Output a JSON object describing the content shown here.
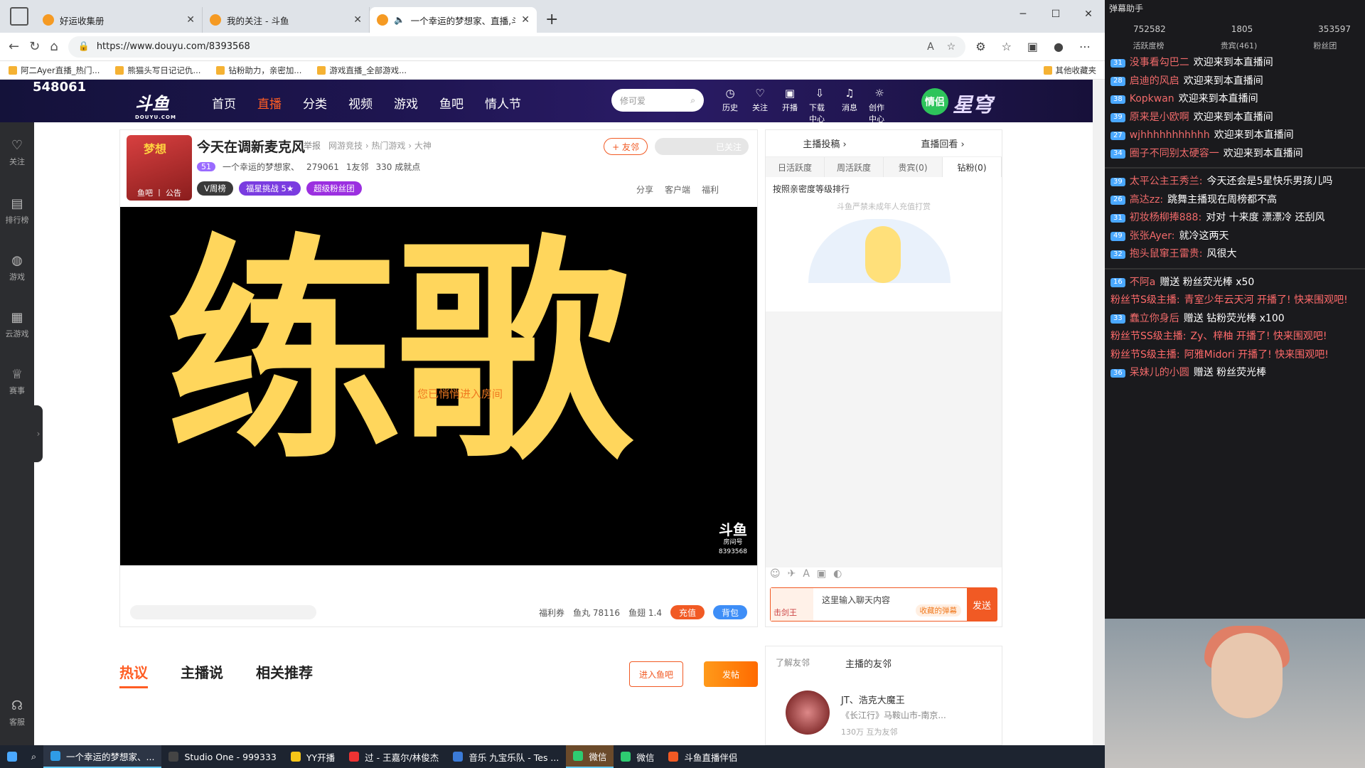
{
  "browser": {
    "tabs": [
      {
        "title": "好运收集册",
        "active": false
      },
      {
        "title": "我的关注 - 斗鱼",
        "active": false
      },
      {
        "title": "一个幸运的梦想家、直播,斗",
        "active": true
      }
    ],
    "url": "https://www.douyu.com/8393568",
    "favorites": [
      "阿二Ayer直播_热门...",
      "熊猫头写日记记仇...",
      "钻粉助力，亲密加...",
      "游戏直播_全部游戏..."
    ],
    "favorites_right": "其他收藏夹"
  },
  "header": {
    "counter": "548061",
    "logo": "斗鱼",
    "logo_sub": "DOUYU.COM",
    "nav": [
      "首页",
      "直播",
      "分类",
      "视频",
      "游戏",
      "鱼吧",
      "情人节"
    ],
    "search_placeholder": "修可爱",
    "icons": [
      "历史",
      "关注",
      "开播",
      "下载中心",
      "消息",
      "创作中心"
    ],
    "badge": "情侣",
    "banner_text": "星穹"
  },
  "left_sidebar": [
    "关注",
    "排行榜",
    "游戏",
    "云游戏",
    "赛事",
    "客服"
  ],
  "room": {
    "avatar_top": "梦想",
    "avatar_bottom": "鱼吧 丨 公告",
    "title": "今天在调新麦克风",
    "report": "举报",
    "category": "网游竞技 › 热门游戏 › 大神",
    "level": "51",
    "anchor": "一个幸运的梦想家、",
    "heat": "279061",
    "friends": "1友邻",
    "achievements": "330 成就点",
    "chips": [
      "V周榜",
      "福星挑战 5★",
      "超级粉丝团"
    ],
    "friend_btn": "+ 友邻",
    "follow_btn": "已关注",
    "tools": [
      "分享",
      "客户端",
      "福利"
    ],
    "video_text": "练歌",
    "enter_msg": "您已悄悄进入房间",
    "watermark": "斗鱼",
    "watermark_sub1": "房间号",
    "watermark_sub2": "8393568",
    "bottom": {
      "coupon": "福利券",
      "fishball": "鱼丸 78116",
      "fishtree": "鱼翅 1.4",
      "recharge": "充值",
      "bag": "背包"
    }
  },
  "subtabs": [
    "热议",
    "主播说",
    "相关推荐"
  ],
  "fish_btn": "进入鱼吧",
  "post_btn": "发帖",
  "right_panel": {
    "top": [
      "主播投稿 ›",
      "直播回看 ›"
    ],
    "tabs": [
      "日活跃度",
      "周活跃度",
      "贵宾(0)",
      "钻粉(0)"
    ],
    "rank_note": "按照亲密度等级排行",
    "minor_note": "斗鱼严禁未成年人充值打赏",
    "chat_left": "击剑王",
    "chat_placeholder": "这里输入聊天内容",
    "chat_tag": "收藏的弹幕",
    "send": "发送"
  },
  "friends_panel": {
    "tab1": "了解友邻",
    "tab2": "主播的友邻",
    "name": "JT、浩克大魔王",
    "desc": "《长江行》马鞍山市-南京...",
    "count": "130万",
    "tag": "互为友邻"
  },
  "danmu": {
    "title": "弹幕助手",
    "stats": [
      "752582",
      "1805",
      "353597"
    ],
    "tabs": [
      "活跃度榜",
      "贵宾(461)",
      "粉丝团"
    ],
    "lines": [
      {
        "badge": "31",
        "user": "没事看勾巴二",
        "msg": "欢迎来到本直播间"
      },
      {
        "badge": "28",
        "user": "启迪的风启",
        "msg": "欢迎来到本直播间"
      },
      {
        "badge": "38",
        "user": "Kopkwan",
        "msg": "欢迎来到本直播间"
      },
      {
        "badge": "39",
        "user": "原来是小欧啊",
        "msg": "欢迎来到本直播间"
      },
      {
        "badge": "27",
        "user": "wjhhhhhhhhhhh",
        "msg": "欢迎来到本直播间"
      },
      {
        "badge": "34",
        "user": "圈子不同别太硬容一",
        "msg": "欢迎来到本直播间"
      }
    ],
    "chat": [
      {
        "badge": "39",
        "user": "太平公主王秀兰:",
        "msg": "今天还会是5星快乐男孩儿吗"
      },
      {
        "badge": "26",
        "user": "高达zz:",
        "msg": "跳舞主播现在周榜都不高"
      },
      {
        "badge": "31",
        "user": "初妆杨柳捧888:",
        "msg": "对对 十来度 漂漂冷 还刮风"
      },
      {
        "badge": "49",
        "user": "张张Ayer:",
        "msg": "就冷这两天"
      },
      {
        "badge": "32",
        "user": "抱头鼠窜王雷贵:",
        "msg": "风很大"
      }
    ],
    "gifts": [
      {
        "badge": "16",
        "user": "不阿a",
        "msg": "赠送 粉丝荧光棒 x50"
      },
      {
        "badge": "",
        "user": "粉丝节S级主播:",
        "msg": "青室少年云天河 开播了! 快来围观吧!"
      },
      {
        "badge": "33",
        "user": "蠢立你身后",
        "msg": "赠送 钻粉荧光棒 x100"
      },
      {
        "badge": "",
        "user": "粉丝节SS级主播:",
        "msg": "Zy、梓柚 开播了! 快来围观吧!"
      },
      {
        "badge": "",
        "user": "粉丝节S级主播:",
        "msg": "阿雅Midori 开播了! 快来围观吧!"
      },
      {
        "badge": "36",
        "user": "呆妹儿的小圆",
        "msg": "赠送 粉丝荧光棒"
      }
    ]
  },
  "taskbar": [
    "一个幸运的梦想家、...",
    "Studio One - 999333",
    "YY开播",
    "过 - 王嘉尔/林俊杰",
    "音乐 九宝乐队 - Tes ...",
    "微信",
    "微信",
    "斗鱼直播伴侣"
  ]
}
